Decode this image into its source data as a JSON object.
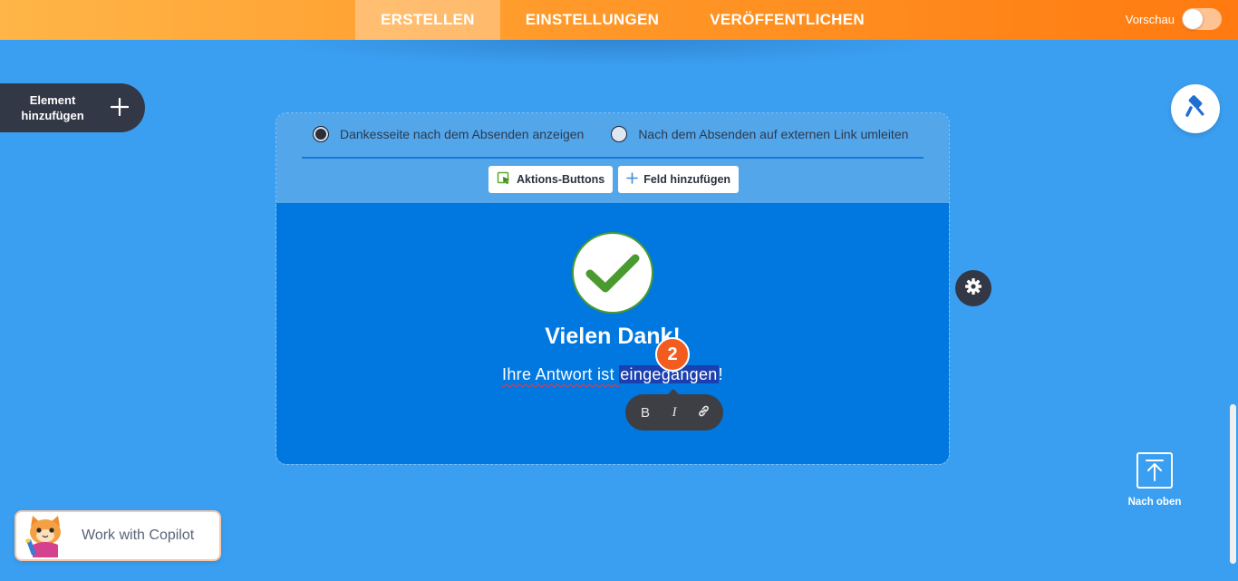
{
  "header": {
    "tabs": [
      {
        "label": "ERSTELLEN",
        "active": true
      },
      {
        "label": "EINSTELLUNGEN",
        "active": false
      },
      {
        "label": "VERÖFFENTLICHEN",
        "active": false
      }
    ],
    "preview_label": "Vorschau",
    "preview_enabled": false
  },
  "sidebar": {
    "add_element_label": "Element hinzufügen"
  },
  "form": {
    "radio_options": [
      {
        "label": "Dankesseite nach dem Absenden anzeigen",
        "checked": true
      },
      {
        "label": "Nach dem Absenden auf externen Link umleiten",
        "checked": false
      }
    ],
    "buttons": {
      "action_buttons_label": "Aktions-Buttons",
      "add_field_label": "Feld hinzufügen"
    },
    "thanks_title": "Vielen Dank!",
    "thanks_text_prefix": "Ihre Antwort ist ",
    "thanks_text_selected": "eingegangen",
    "thanks_text_suffix": "!",
    "step_badge": "2"
  },
  "format_toolbar": {
    "bold": "B",
    "italic": "I"
  },
  "back_to_top_label": "Nach oben",
  "copilot_label": "Work with Copilot",
  "colors": {
    "background": "#3b9ff1",
    "accent_orange": "#ff7a10",
    "thank_you_panel": "#0178df",
    "check_green": "#4a9a2f",
    "badge": "#f25d1f"
  }
}
